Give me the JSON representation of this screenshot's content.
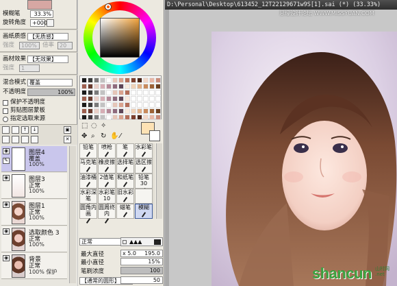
{
  "brush_panel": {
    "blur_label": "模糊笔",
    "blur_value": "33.3%",
    "rotation_label": "旋转角度",
    "rotation_value": "+000"
  },
  "paper_texture": {
    "label": "画纸质感",
    "value": "【无质感】",
    "sub_label": "强度",
    "sub_value_a": "100%",
    "sub_label_b": "倍率",
    "sub_value_b": "20"
  },
  "material_effect": {
    "label": "画材效果",
    "value": "【无效果】",
    "sub_label": "强度",
    "sub_value": "1"
  },
  "layer_props": {
    "blend_label": "混合模式",
    "blend_value": "覆盖",
    "opacity_label": "不透明度",
    "opacity_value": "100%",
    "protect_opacity": "保护不透明度",
    "clip_group": "剪贴图层蒙板",
    "select_source": "指定选取来源"
  },
  "layers": [
    {
      "name": "图层4",
      "mode": "覆盖",
      "opacity": "100%"
    },
    {
      "name": "图层3",
      "mode": "正常",
      "opacity": "100%"
    },
    {
      "name": "图层1",
      "mode": "正常",
      "opacity": "100%"
    },
    {
      "name": "选取颜色 3",
      "mode": "正常",
      "opacity": "100%"
    },
    {
      "name": "背景",
      "mode": "正常",
      "opacity": "100% 保护"
    }
  ],
  "tools": [
    [
      "铅笔",
      "喷枪",
      "笔",
      "水彩笔"
    ],
    [
      "马克笔",
      "橡皮擦",
      "选择笔",
      "选区擦"
    ],
    [
      "油漆桶",
      "2值笔",
      "和纸笔",
      "铅笔30"
    ],
    [
      "水彩深笔",
      "水彩笔10",
      "旧水彩",
      ""
    ],
    [
      "圆角内画",
      "圆周终内",
      "蜡笔",
      "模糊"
    ]
  ],
  "brush_settings": {
    "mode": "正常",
    "max_size_label": "最大直径",
    "max_size_multiplier": "x 5.0",
    "max_size_value": "195.0",
    "min_size_label": "最小直径",
    "min_size_value": "15%",
    "density_label": "笔刷浓度",
    "density_value": "100",
    "shape_label": "【通常的圆形】",
    "shape_value": "50"
  },
  "colors": {
    "selected_primary": "#fde2b4",
    "selected_secondary": "#ffffff",
    "accent_selection": "#c9c6ec"
  },
  "canvas": {
    "title": "D:\\Personal\\Desktop\\613452_12T22129671w9S[1].sai (*) (33.33%)",
    "watermark_top": "思缘设计论坛  WWW.MISSYUAN.COM",
    "watermark_bottom": "shancun",
    "watermark_bottom_suffix": "山村网\n.net"
  }
}
